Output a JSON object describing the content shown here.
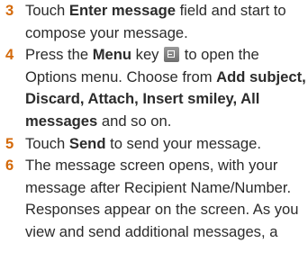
{
  "colors": {
    "step_number": "#d46a0b",
    "text": "#2b2b2b"
  },
  "steps": [
    {
      "number": "3",
      "t1": "Touch ",
      "b1": "Enter message",
      "t2": " field and start to compose your message."
    },
    {
      "number": "4",
      "t1": "Press the ",
      "b1": "Menu",
      "t2": " key ",
      "icon": "menu-key-icon",
      "t3": " to open the Options menu. Choose from ",
      "b2": "Add subject, Discard, Attach, Insert smiley, All messages",
      "t4": " and so on."
    },
    {
      "number": "5",
      "t1": "Touch ",
      "b1": "Send",
      "t2": " to send your message."
    },
    {
      "number": "6",
      "t1": "The message screen opens, with your message after Recipient Name/Number. Responses appear on the screen. As you view and send additional messages, a"
    }
  ]
}
